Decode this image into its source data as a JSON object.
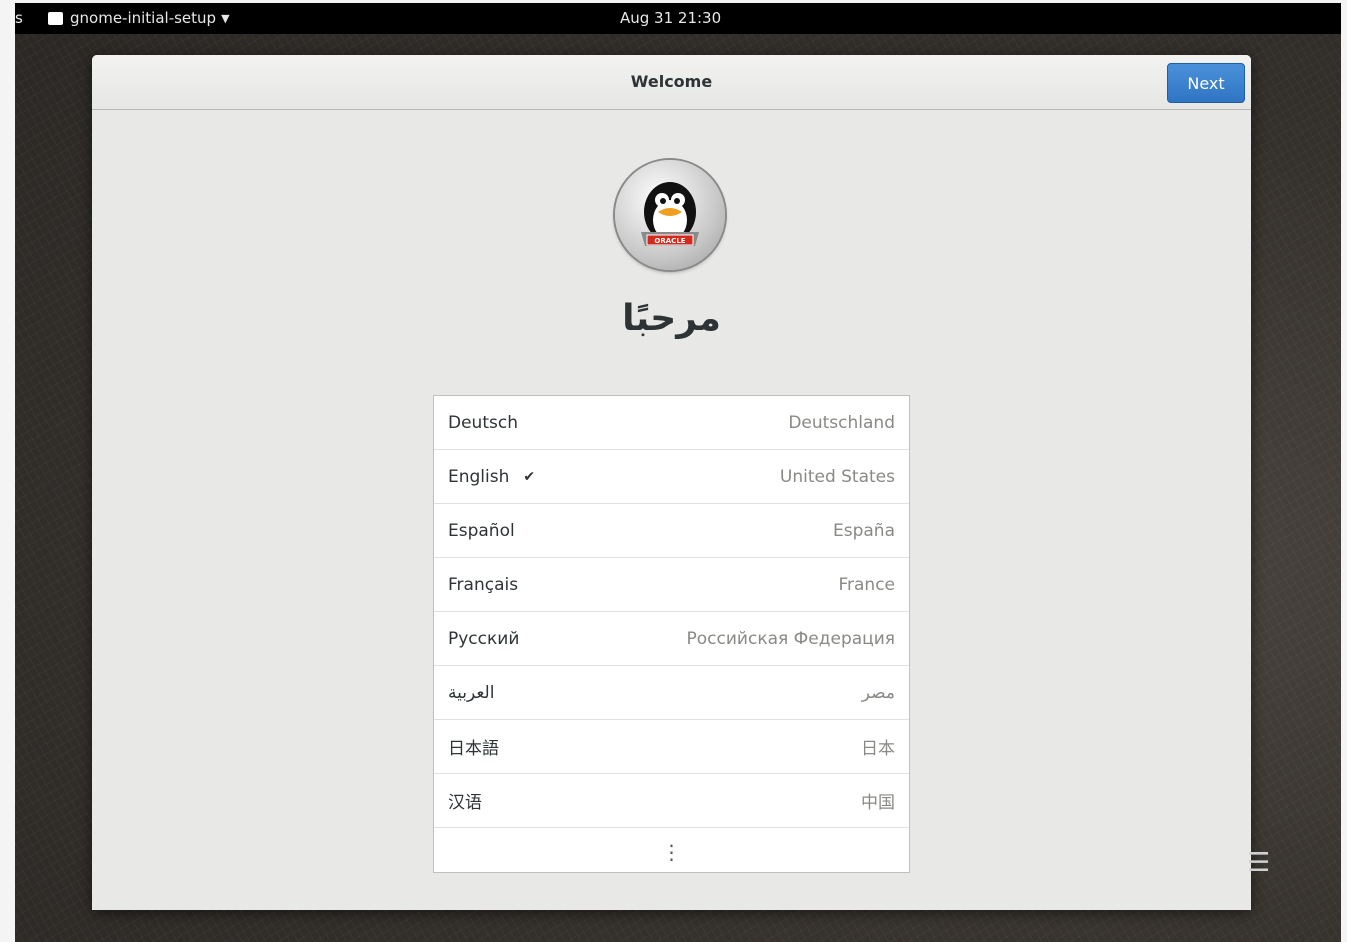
{
  "topbar": {
    "activities_label": "s",
    "app_name": "gnome-initial-setup",
    "clock": "Aug 31  21:30"
  },
  "window": {
    "title": "Welcome",
    "next_label": "Next",
    "heading": "مرحبًا",
    "logo_text": "ORACLE"
  },
  "languages": [
    {
      "name": "Deutsch",
      "country": "Deutschland",
      "selected": false
    },
    {
      "name": "English",
      "country": "United States",
      "selected": true
    },
    {
      "name": "Español",
      "country": "España",
      "selected": false
    },
    {
      "name": "Français",
      "country": "France",
      "selected": false
    },
    {
      "name": "Русский",
      "country": "Российская Федерация",
      "selected": false
    },
    {
      "name": "العربية",
      "country": "مصر",
      "selected": false
    },
    {
      "name": "日本語",
      "country": "日本",
      "selected": false
    },
    {
      "name": "汉语",
      "country": "中国",
      "selected": false
    }
  ],
  "check_glyph": "✔",
  "more_glyph": "⋮",
  "icons": {
    "app": "window-icon",
    "menu": "caret-down-icon",
    "more": "vertical-ellipsis-icon",
    "check": "checkmark-icon"
  }
}
